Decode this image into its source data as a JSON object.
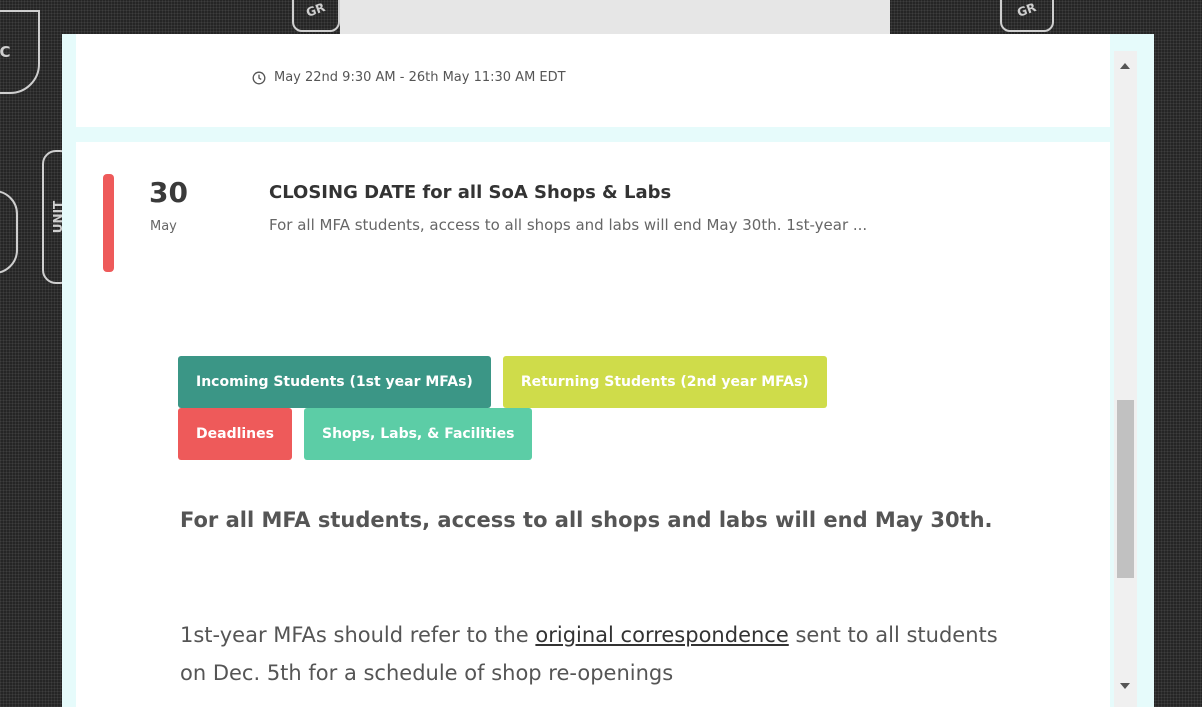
{
  "background": {
    "marks": [
      "C",
      "UNIT",
      "GR",
      "GR"
    ]
  },
  "event_previous": {
    "time": "May 22nd 9:30 AM - 26th May 11:30 AM EDT",
    "icon": "clock-icon"
  },
  "event": {
    "day": "30",
    "month": "May",
    "title": "CLOSING DATE for all SoA Shops & Labs",
    "summary": "For all MFA students, access to all shops and labs will end May 30th.  1st-year ...",
    "tags": [
      {
        "label": "Incoming Students (1st year MFAs)",
        "color": "#3b9686"
      },
      {
        "label": "Returning Students (2nd year MFAs)",
        "color": "#cfdc4a"
      },
      {
        "label": "Deadlines",
        "color": "#ee5a5a"
      },
      {
        "label": "Shops, Labs, & Facilities",
        "color": "#5ccda6"
      }
    ],
    "lead": "For all MFA students, access to all shops and labs will end May 30th.",
    "body_before_link": "1st-year MFAs should refer to the ",
    "body_link": "original correspondence",
    "body_after_link": " sent to all students on Dec. 5th for a schedule of shop re-openings"
  },
  "colors": {
    "accent_red": "#ee5a5a",
    "modal_bg": "#e6fbfb"
  }
}
